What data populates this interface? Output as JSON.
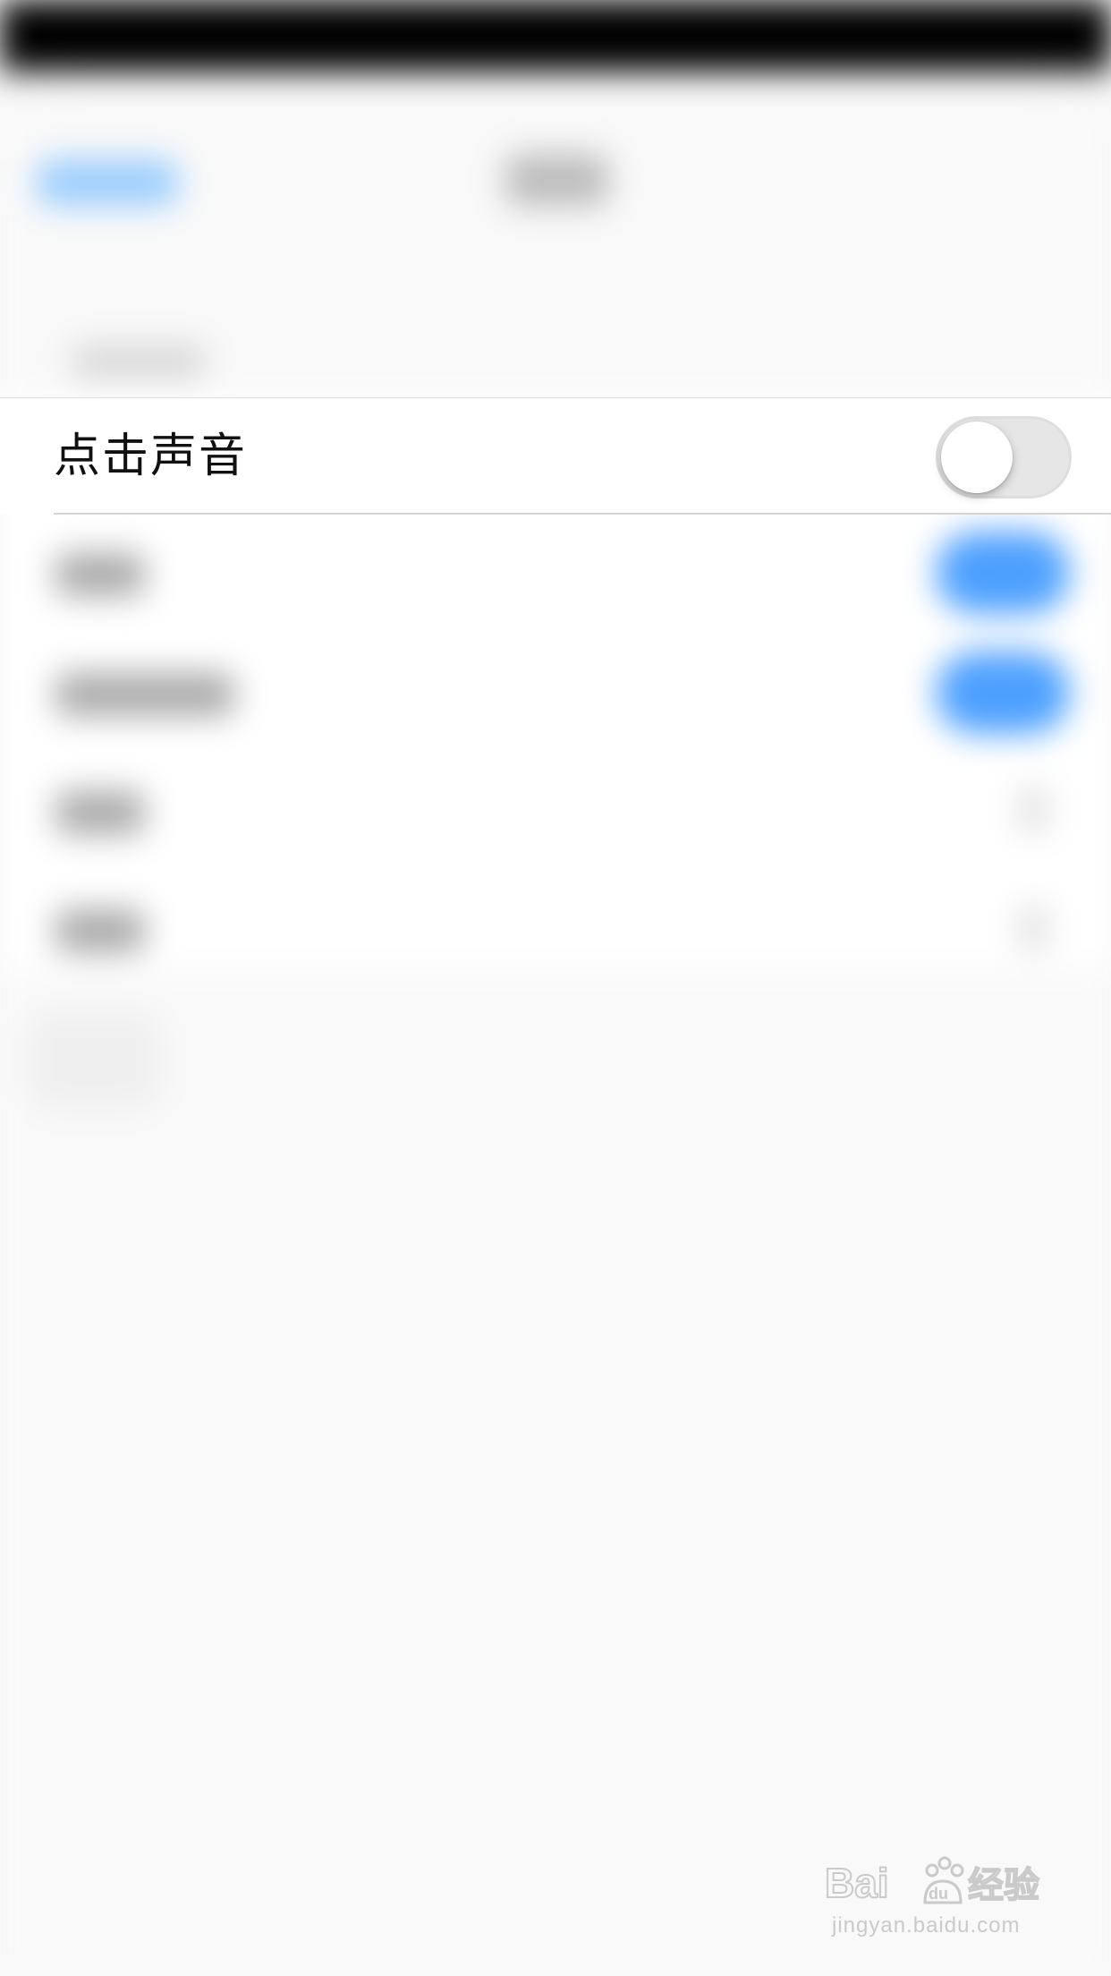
{
  "settings_row": {
    "label": "点击声音",
    "toggle_state": "off"
  },
  "watermark": {
    "logo_text": "Bai du 经验",
    "url": "jingyan.baidu.com"
  },
  "colors": {
    "toggle_on": "#4da0ff",
    "toggle_off": "#e6e6e6",
    "background": "#f9f9f9",
    "text": "#111111"
  }
}
